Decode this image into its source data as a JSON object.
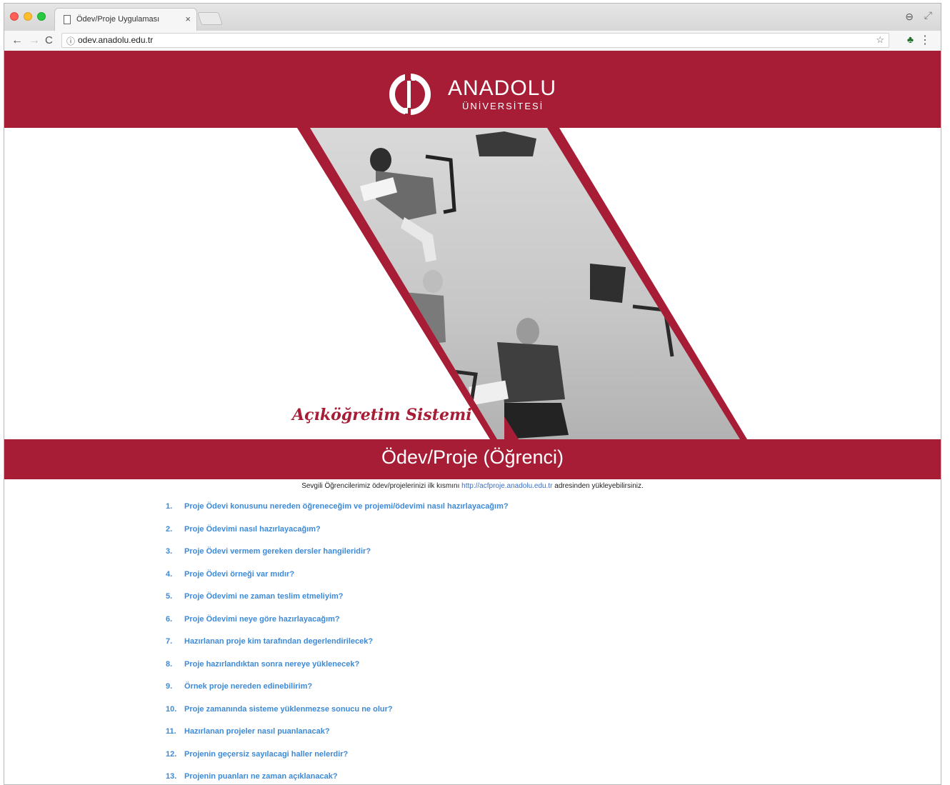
{
  "browser": {
    "tab_title": "Ödev/Proje Uygulaması",
    "tab_close": "×",
    "url": "odev.anadolu.edu.tr",
    "icons": {
      "back": "←",
      "forward": "→",
      "reload": "C",
      "info": "ⓘ",
      "star": "☆",
      "extension": "♣",
      "menu": "⋮",
      "profile": "⊖",
      "fullscreen": "⤢"
    }
  },
  "header": {
    "logo_name": "ANADOLU",
    "logo_sub": "ÜNİVERSİTESİ"
  },
  "hero": {
    "tagline": "Açıköğretim Sistemi"
  },
  "title": "Ödev/Proje (Öğrenci)",
  "notice": {
    "before": "Sevgili Öğrencilerimiz ödev/projelerinizi ilk kısmını",
    "link": "http://acfproje.anadolu.edu.tr",
    "after": "adresinden yükleyebilirsiniz."
  },
  "faq": [
    {
      "num": "1.",
      "text": "Proje Ödevi konusunu nereden öğreneceğim ve projemi/ödevimi nasıl hazırlayacağım?"
    },
    {
      "num": "2.",
      "text": "Proje Ödevimi nasıl hazırlayacağım?"
    },
    {
      "num": "3.",
      "text": "Proje Ödevi vermem gereken dersler hangileridir?"
    },
    {
      "num": "4.",
      "text": "Proje Ödevi örneği var mıdır?"
    },
    {
      "num": "5.",
      "text": "Proje Ödevimi ne zaman teslim etmeliyim?"
    },
    {
      "num": "6.",
      "text": "Proje Ödevimi neye göre hazırlayacağım?"
    },
    {
      "num": "7.",
      "text": "Hazırlanan proje kim tarafından degerlendirilecek?"
    },
    {
      "num": "8.",
      "text": "Proje hazırlandıktan sonra nereye yüklenecek?"
    },
    {
      "num": "9.",
      "text": "Örnek proje nereden edinebilirim?"
    },
    {
      "num": "10.",
      "text": "Proje zamanında sisteme yüklenmezse sonucu ne olur?"
    },
    {
      "num": "11.",
      "text": "Hazırlanan projeler nasıl puanlanacak?"
    },
    {
      "num": "12.",
      "text": "Projenin geçersiz sayılacagi haller nelerdir?"
    },
    {
      "num": "13.",
      "text": "Projenin puanları ne zaman açıklanacak?"
    }
  ],
  "colors": {
    "brand": "#a71d36",
    "link": "#3d8ad8"
  }
}
